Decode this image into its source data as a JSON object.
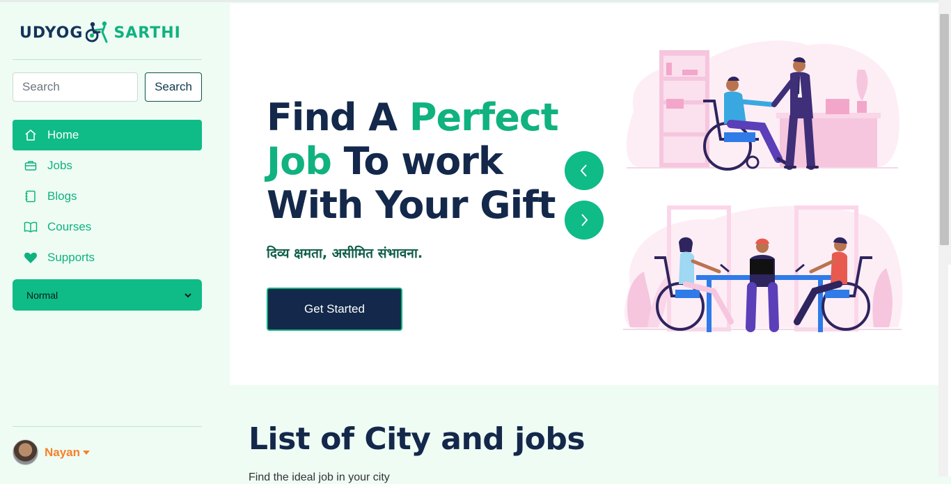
{
  "brand": {
    "word1": "UDYOG",
    "word2": "SARTHI",
    "logo_icon": "wheelchair-handshake-icon"
  },
  "search": {
    "placeholder": "Search",
    "button_label": "Search"
  },
  "nav": [
    {
      "label": "Home",
      "icon": "home-icon",
      "active": true
    },
    {
      "label": "Jobs",
      "icon": "briefcase-icon",
      "active": false
    },
    {
      "label": "Blogs",
      "icon": "notebook-icon",
      "active": false
    },
    {
      "label": "Courses",
      "icon": "book-open-icon",
      "active": false
    },
    {
      "label": "Supports",
      "icon": "heart-icon",
      "active": false
    }
  ],
  "mode_select": {
    "value": "Normal"
  },
  "user": {
    "name": "Nayan"
  },
  "hero": {
    "title_part1": "Find A ",
    "title_accent": "Perfect Job",
    "title_part2": " To work With Your Gift",
    "subtitle": "दिव्य क्षमता, असीमित संभावना.",
    "cta_label": "Get Started",
    "prev_icon": "chevron-left-icon",
    "next_icon": "chevron-right-icon"
  },
  "section": {
    "title": "List of City and jobs",
    "subtitle": "Find the ideal job in your city"
  },
  "colors": {
    "accent": "#10b27f",
    "navy": "#13284a",
    "sidebar_bg": "#eefcf4",
    "user_orange": "#f7802a",
    "illustration_pink": "#fbcfe6",
    "illustration_blue": "#2f7be8",
    "illustration_purple": "#5a3fb8"
  }
}
